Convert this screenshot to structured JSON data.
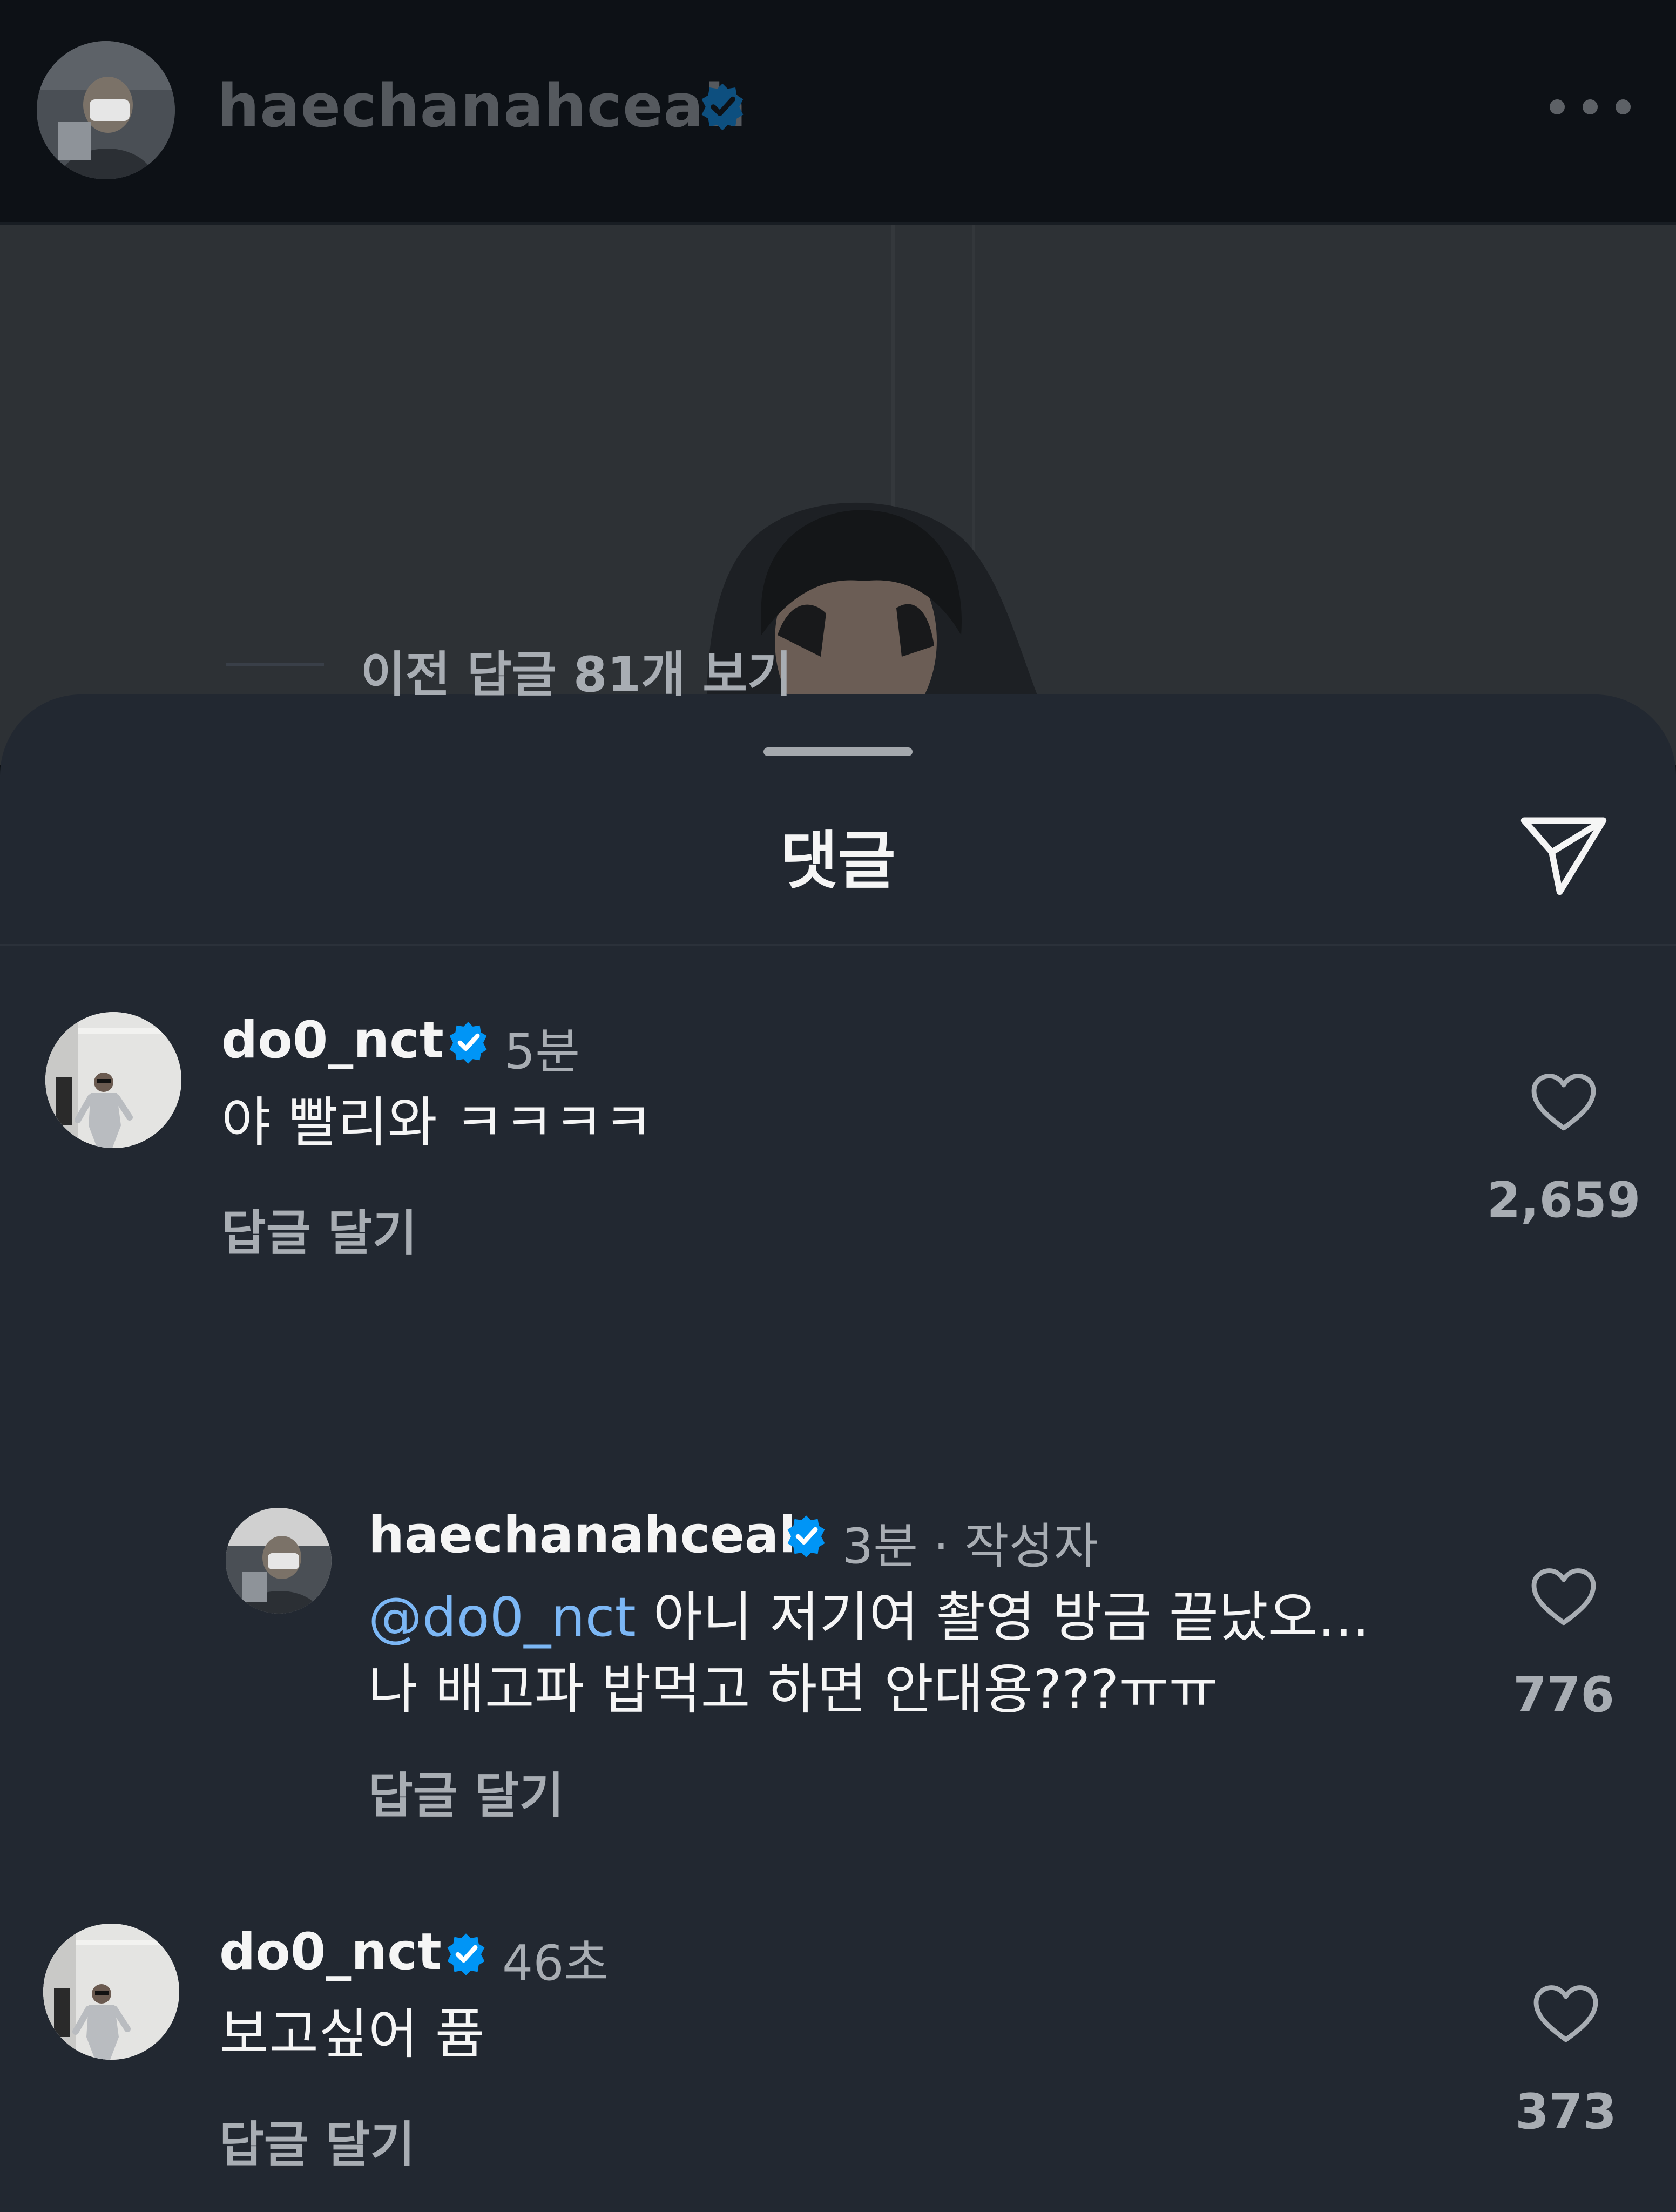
{
  "header": {
    "username": "haechanahceah"
  },
  "sheet": {
    "title": "댓글"
  },
  "comments": [
    {
      "username": "do0_nct",
      "time": "5분",
      "text": "야 빨리와 ㅋㅋㅋㅋ",
      "reply_label": "답글 달기",
      "likes": "2,659"
    }
  ],
  "view_replies": "이전 답글 81개 보기",
  "reply": {
    "username": "haechanahceah",
    "time": "3분 · 작성자",
    "mention": "@do0_nct",
    "text_line1": " 아니 저기여 촬영 방금 끝났오...",
    "text_line2": "나 배고파 밥먹고 하면 안대용???ㅠㅠ",
    "reply_label": "답글 달기",
    "likes": "776"
  },
  "comment2": {
    "username": "do0_nct",
    "time": "46초",
    "text": "보고싶어 퓸",
    "reply_label": "답글 달기",
    "likes": "373"
  },
  "colors": {
    "background": "#0c1014",
    "sheet": "#222831",
    "verified": "#0095f6",
    "mention": "#7cb7f5",
    "secondary_text": "#a8adb3"
  },
  "icons": {
    "verified": "verified-badge-icon",
    "heart": "heart-outline-icon",
    "share": "paper-plane-icon",
    "more": "more-horizontal-icon"
  }
}
